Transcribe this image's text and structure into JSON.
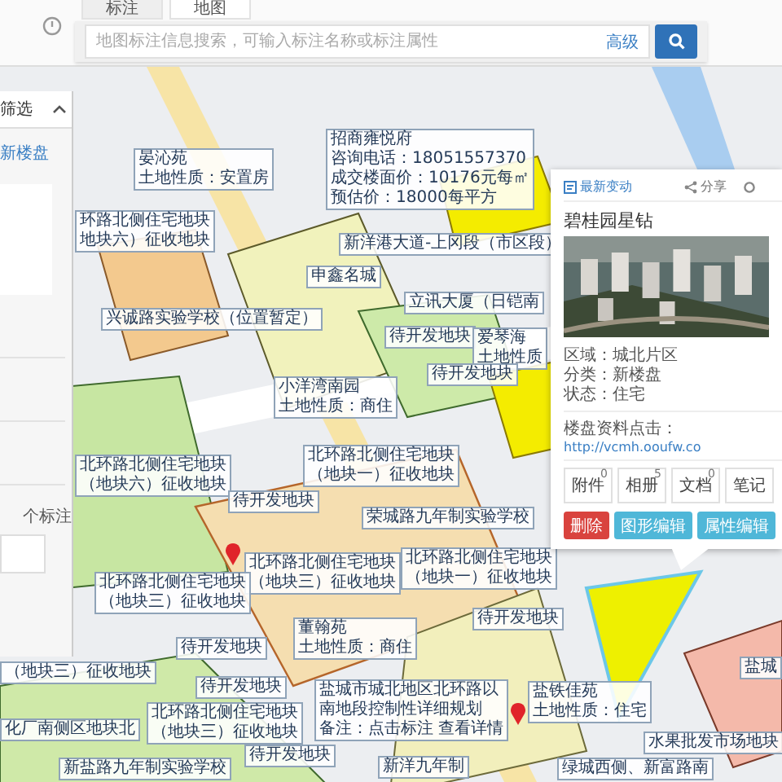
{
  "tabs": [
    {
      "label": "标注",
      "selected": true
    },
    {
      "label": "地图",
      "selected": false
    }
  ],
  "search": {
    "placeholder": "地图标注信息搜索，可输入标注名称或标注属性",
    "advanced": "高级"
  },
  "filter_panel": {
    "title": "筛选",
    "link": "新楼盘",
    "count_label": "个标注"
  },
  "map_labels": [
    {
      "lines": [
        "晏沁苑",
        "土地性质：安置房"
      ]
    },
    {
      "lines": [
        "环路北侧住宅地块",
        "地块六）征收地块"
      ]
    },
    {
      "lines": [
        "兴诚路实验学校（位置暂定）"
      ]
    },
    {
      "lines": [
        "招商雍悦府",
        "咨询电话：18051557370",
        "成交楼面价：10176元每㎡",
        "预估价：18000每平方"
      ]
    },
    {
      "lines": [
        "新洋港大道-上冈段（市区段）"
      ]
    },
    {
      "lines": [
        "申鑫名城"
      ]
    },
    {
      "lines": [
        "立讯大厦（日铠南"
      ]
    },
    {
      "lines": [
        "待开发地块"
      ]
    },
    {
      "lines": [
        "爱琴海",
        "土地性质"
      ]
    },
    {
      "lines": [
        "待开发地块"
      ]
    },
    {
      "lines": [
        "小洋湾南园",
        "土地性质：商住"
      ]
    },
    {
      "lines": [
        "北环路北侧住宅地块",
        "（地块一）征收地块"
      ]
    },
    {
      "lines": [
        "荣城路九年制实验学校"
      ]
    },
    {
      "lines": [
        "北环路北侧住宅地块",
        "（地块三）征收地块"
      ]
    },
    {
      "lines": [
        "北环路北侧住宅地块",
        "（地块一）征收地块"
      ]
    },
    {
      "lines": [
        "待开发地块"
      ]
    },
    {
      "lines": [
        "待开发地块"
      ]
    },
    {
      "lines": [
        "董翰苑",
        "土地性质：商住"
      ]
    },
    {
      "lines": [
        "待开发地块"
      ]
    },
    {
      "lines": [
        "盐城市城北地区北环路以",
        "南地段控制性详细规划",
        "备注：点击标注 查看详情"
      ]
    },
    {
      "lines": [
        "待开发地块"
      ]
    },
    {
      "lines": [
        "新洋九年制"
      ]
    },
    {
      "lines": [
        "北环路北侧住宅地块",
        "（地块六）征收地块"
      ]
    },
    {
      "lines": [
        "待开发地块"
      ]
    },
    {
      "lines": [
        "北环路北侧住宅地块",
        "（地块三）征收地块"
      ]
    },
    {
      "lines": [
        "（地块三）征收地块"
      ]
    },
    {
      "lines": [
        "化厂南侧区地块北"
      ]
    },
    {
      "lines": [
        "北环路北侧住宅地块",
        "（地块三）征收地块"
      ]
    },
    {
      "lines": [
        "新盐路九年制实验学校"
      ]
    },
    {
      "lines": [
        "盐铁佳苑",
        "土地性质：住宅"
      ]
    },
    {
      "lines": [
        "水果批发市场地块"
      ]
    },
    {
      "lines": [
        "绿城西侧、新富路南"
      ]
    },
    {
      "lines": [
        "盐城"
      ]
    }
  ],
  "popup": {
    "actions": [
      {
        "label": "最新变动",
        "kind": "changes"
      },
      {
        "label": "分享",
        "kind": "share"
      }
    ],
    "title": "碧桂园星钻",
    "fields": [
      "区域：城北片区",
      "分类：新楼盘",
      "状态：住宅"
    ],
    "link_label": "楼盘资料点击：",
    "link": "http://vcmh.ooufw.co",
    "counters": [
      {
        "label": "附件",
        "count": "0"
      },
      {
        "label": "相册",
        "count": "5"
      },
      {
        "label": "文档",
        "count": "0"
      },
      {
        "label": "笔记"
      }
    ],
    "buttons": [
      {
        "label": "删除",
        "kind": "danger"
      },
      {
        "label": "图形编辑",
        "kind": "info"
      },
      {
        "label": "属性编辑",
        "kind": "info"
      }
    ]
  }
}
